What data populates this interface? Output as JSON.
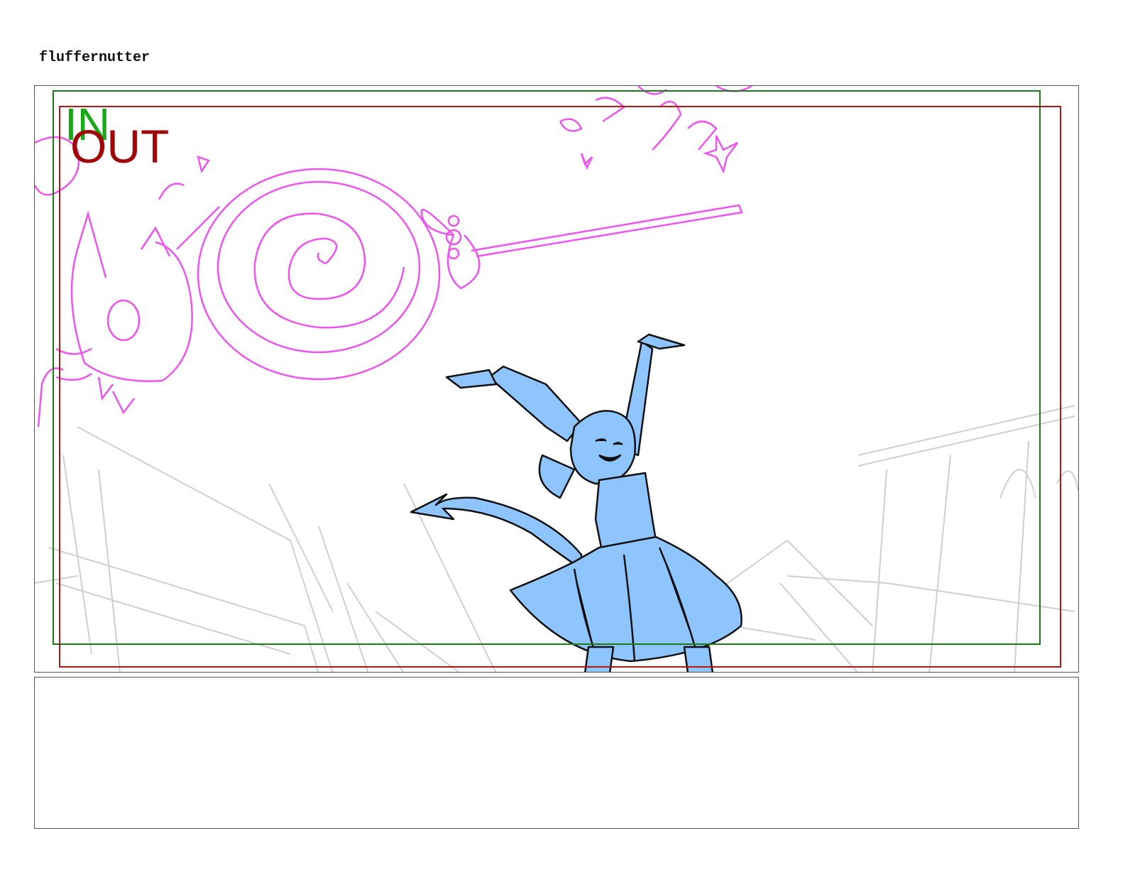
{
  "header": {
    "title": "fluffernutter"
  },
  "panel": {
    "in_label": "IN",
    "out_label": "OUT",
    "colors": {
      "in_frame": "#1a7a1a",
      "out_frame": "#b01818",
      "magic_sketch": "#ee55ee",
      "character_fill": "#8ec5ff",
      "background_sketch": "#cfcfcf"
    }
  },
  "notes": {
    "text": ""
  }
}
